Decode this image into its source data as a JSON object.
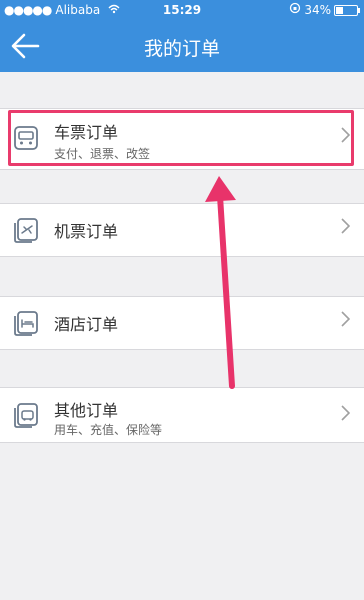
{
  "status_bar": {
    "carrier": "Alibaba",
    "time": "15:29",
    "battery": "34%"
  },
  "header": {
    "title": "我的订单"
  },
  "orders": [
    {
      "label": "车票订单",
      "sub": "支付、退票、改签",
      "icon": "train-icon"
    },
    {
      "label": "机票订单",
      "sub": "",
      "icon": "plane-ticket-icon"
    },
    {
      "label": "酒店订单",
      "sub": "",
      "icon": "hotel-bed-icon"
    },
    {
      "label": "其他订单",
      "sub": "用车、充值、保险等",
      "icon": "car-icon"
    }
  ],
  "colors": {
    "header": "#3b8fdd",
    "highlight": "#e93b6c"
  }
}
